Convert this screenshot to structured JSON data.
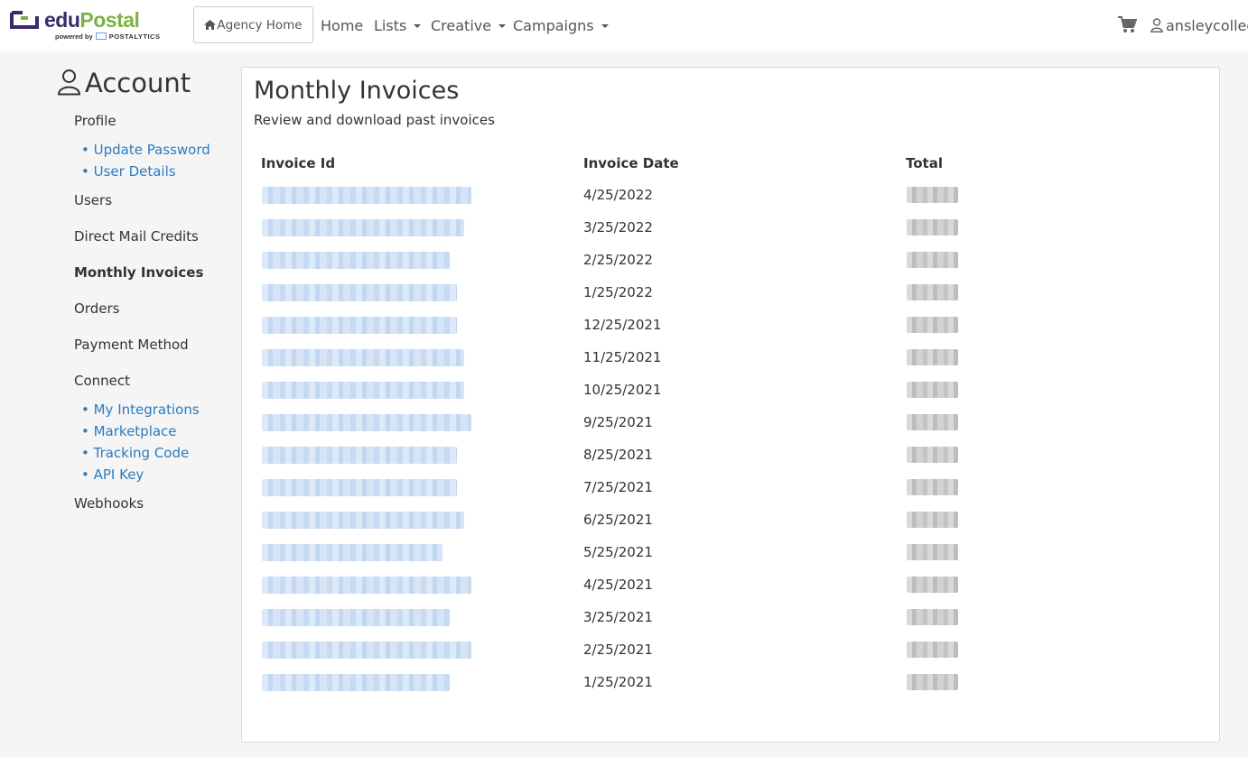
{
  "brand": {
    "name_part1": "edu",
    "name_part2": "Postal",
    "powered_by": "powered by",
    "partner": "POSTALYTICS",
    "primary_color": "#3a2a6b",
    "accent_color": "#7ab342"
  },
  "nav": {
    "agency_home": "Agency Home",
    "home": "Home",
    "lists": "Lists",
    "creative": "Creative",
    "campaigns": "Campaigns",
    "username": "ansleycollege"
  },
  "sidebar": {
    "title": "Account",
    "profile": "Profile",
    "update_password": "• Update Password",
    "user_details": "• User Details",
    "users": "Users",
    "direct_mail_credits": "Direct Mail Credits",
    "monthly_invoices": "Monthly Invoices",
    "orders": "Orders",
    "payment_method": "Payment Method",
    "connect": "Connect",
    "my_integrations": "• My Integrations",
    "marketplace": "• Marketplace",
    "tracking_code": "• Tracking Code",
    "api_key": "• API Key",
    "webhooks": "Webhooks",
    "link_color": "#2a7bc0"
  },
  "main": {
    "title": "Monthly Invoices",
    "subtitle": "Review and download past invoices",
    "columns": [
      "Invoice Id",
      "Invoice Date",
      "Total"
    ],
    "rows": [
      {
        "date": "4/25/2022"
      },
      {
        "date": "3/25/2022"
      },
      {
        "date": "2/25/2022"
      },
      {
        "date": "1/25/2022"
      },
      {
        "date": "12/25/2021"
      },
      {
        "date": "11/25/2021"
      },
      {
        "date": "10/25/2021"
      },
      {
        "date": "9/25/2021"
      },
      {
        "date": "8/25/2021"
      },
      {
        "date": "7/25/2021"
      },
      {
        "date": "6/25/2021"
      },
      {
        "date": "5/25/2021"
      },
      {
        "date": "4/25/2021"
      },
      {
        "date": "3/25/2021"
      },
      {
        "date": "2/25/2021"
      },
      {
        "date": "1/25/2021"
      }
    ]
  }
}
